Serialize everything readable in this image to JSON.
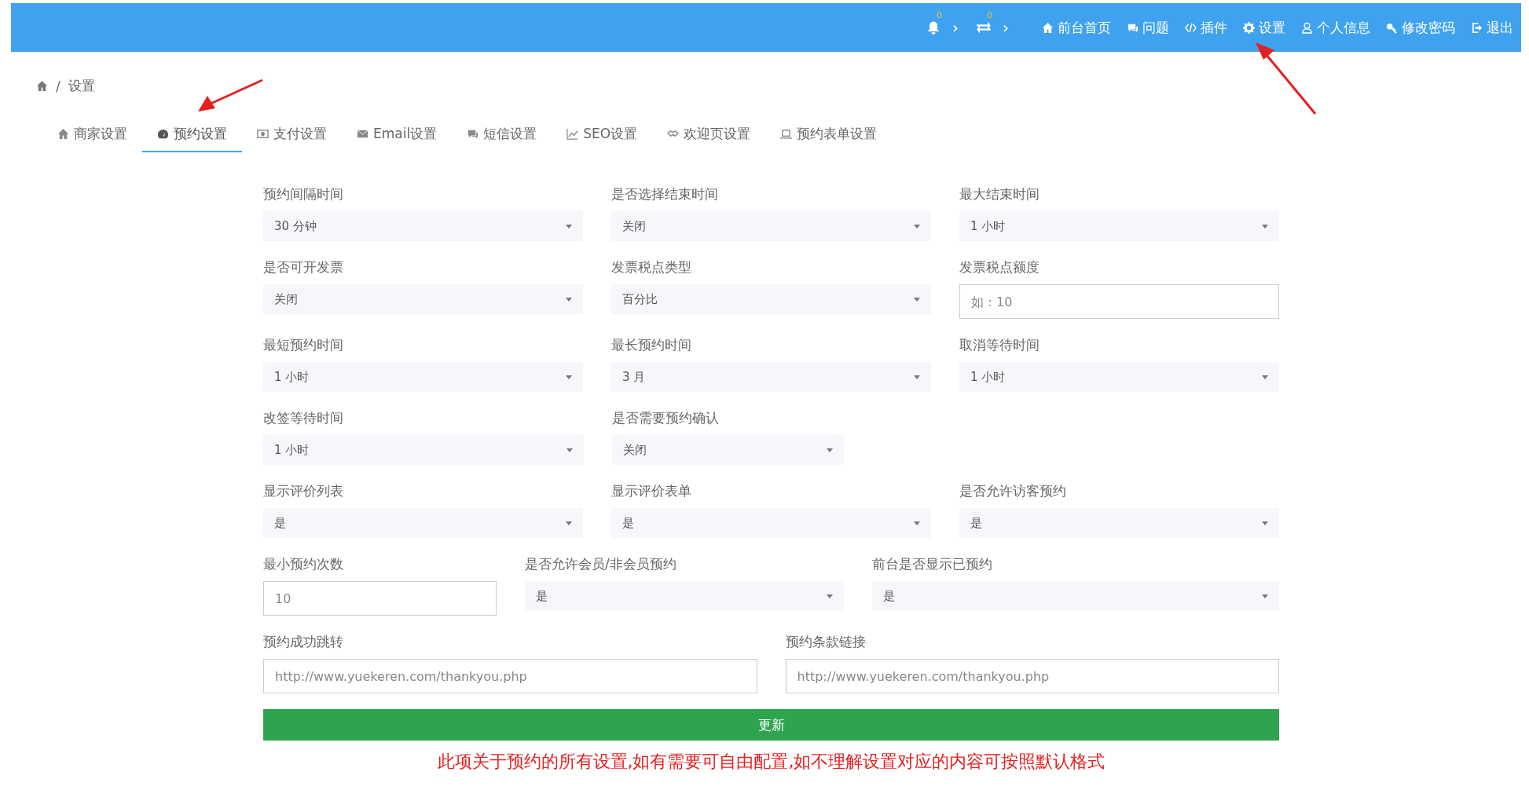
{
  "top_bar": {
    "notifications": [
      {
        "kind": "bell",
        "count": "0",
        "chevron": "›"
      },
      {
        "kind": "transfer",
        "count": "0",
        "chevron": "›"
      }
    ],
    "links": [
      {
        "label": "前台首页"
      },
      {
        "label": "问题"
      },
      {
        "label": "插件"
      },
      {
        "label": "设置"
      },
      {
        "label": "个人信息"
      },
      {
        "label": "修改密码"
      },
      {
        "label": "退出"
      }
    ]
  },
  "breadcrumb": {
    "separator": "/",
    "current": "设置"
  },
  "tabs": [
    {
      "label": "商家设置",
      "selected": false
    },
    {
      "label": "预约设置",
      "selected": true
    },
    {
      "label": "支付设置",
      "selected": false
    },
    {
      "label": "Email设置",
      "selected": false
    },
    {
      "label": "短信设置",
      "selected": false
    },
    {
      "label": "SEO设置",
      "selected": false
    },
    {
      "label": "欢迎页设置",
      "selected": false
    },
    {
      "label": "预约表单设置",
      "selected": false
    }
  ],
  "form_rows": [
    [
      {
        "kind": "select",
        "label": "预约间隔时间",
        "value": "30 分钟"
      },
      {
        "kind": "select",
        "label": "是否选择结束时间",
        "value": "关闭"
      },
      {
        "kind": "select",
        "label": "最大结束时间",
        "value": "1 小时"
      }
    ],
    [
      {
        "kind": "select",
        "label": "是否可开发票",
        "value": "关闭"
      },
      {
        "kind": "select",
        "label": "发票税点类型",
        "value": "百分比"
      },
      {
        "kind": "input",
        "label": "发票税点额度",
        "placeholder": "如：10"
      }
    ],
    [
      {
        "kind": "select",
        "label": "最短预约时间",
        "value": "1 小时"
      },
      {
        "kind": "select",
        "label": "最长预约时间",
        "value": "3 月"
      },
      {
        "kind": "select",
        "label": "取消等待时间",
        "value": "1 小时"
      }
    ],
    [
      {
        "kind": "select",
        "label": "改签等待时间",
        "value": "1 小时"
      },
      {
        "kind": "select",
        "label": "是否需要预约确认",
        "value": "关闭"
      }
    ],
    [
      {
        "kind": "select",
        "label": "显示评价列表",
        "value": "是"
      },
      {
        "kind": "select",
        "label": "显示评价表单",
        "value": "是"
      },
      {
        "kind": "select",
        "label": "是否允许访客预约",
        "value": "是"
      }
    ],
    [
      {
        "kind": "input",
        "label": "最小预约次数",
        "placeholder": "10"
      },
      {
        "kind": "select",
        "label": "是否允许会员/非会员预约",
        "value": "是"
      },
      {
        "kind": "select",
        "label": "前台是否显示已预约",
        "value": "是"
      }
    ],
    [
      {
        "kind": "input",
        "label": "预约成功跳转",
        "placeholder": "http://www.yuekeren.com/thankyou.php"
      },
      {
        "kind": "input",
        "label": "预约条款链接",
        "placeholder": "http://www.yuekeren.com/thankyou.php"
      }
    ]
  ],
  "submit_button": "更新",
  "note": "此项关于预约的所有设置,如有需要可自由配置,如不理解设置对应的内容可按照默认格式"
}
